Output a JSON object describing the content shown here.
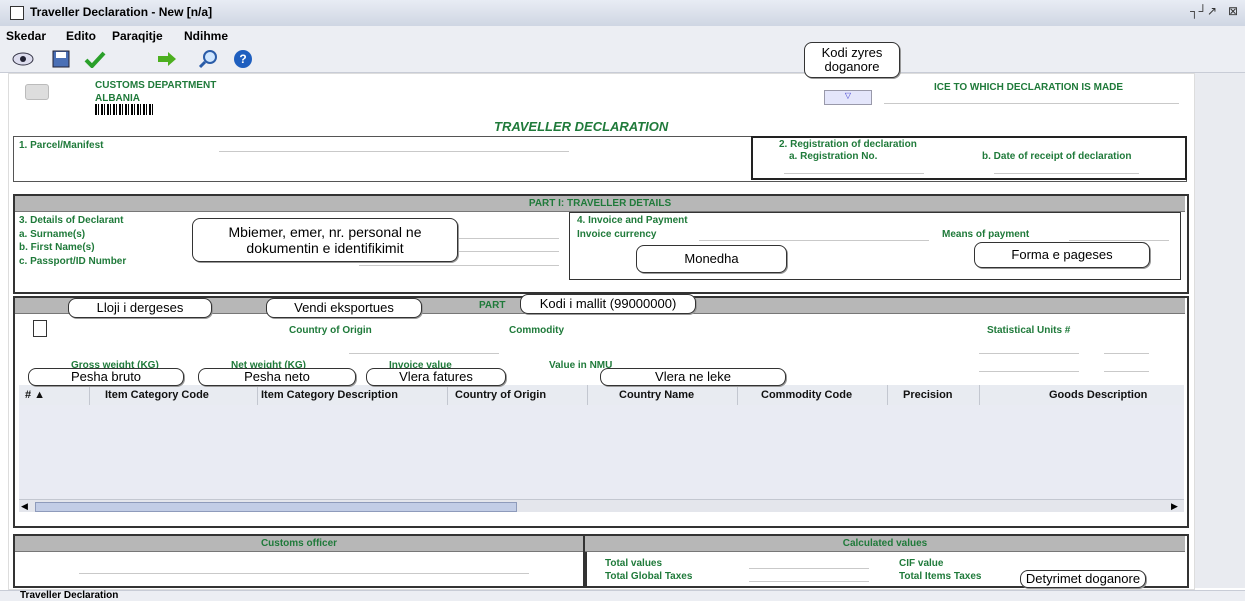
{
  "window": {
    "title": "Traveller Declaration - New [n/a]",
    "controls": [
      "┐┘",
      "↗",
      "⊠"
    ]
  },
  "menu": [
    "Skedar",
    "Edito",
    "Paraqitje",
    "Ndihme"
  ],
  "header": {
    "dept": "CUSTOMS DEPARTMENT",
    "country": "ALBANIA",
    "office_label": "ICE TO WHICH DECLARATION IS MADE",
    "form_title": "TRAVELLER DECLARATION"
  },
  "sections": {
    "parcel": "1. Parcel/Manifest",
    "registration": "2. Registration of declaration",
    "reg_no": "a. Registration No.",
    "receipt_date": "b. Date of receipt of declaration",
    "part1": "PART I: TRAVELLER DETAILS",
    "declarant": "3. Details of Declarant",
    "surname": "a. Surname(s)",
    "first_name": "b. First Name(s)",
    "passport": "c. Passport/ID Number",
    "invoice": "4. Invoice and Payment",
    "invoice_currency": "Invoice currency",
    "means_payment": "Means of payment",
    "part2": "PART",
    "country_origin": "Country of Origin",
    "commodity": "Commodity",
    "stat_units": "Statistical Units #",
    "gross_weight": "Gross weight (KG)",
    "net_weight": "Net weight (KG)",
    "invoice_value": "Invoice value",
    "value_nmu": "Value in NMU",
    "customs_officer": "Customs officer",
    "calculated": "Calculated values",
    "total_values": "Total values",
    "total_global_taxes": "Total Global Taxes",
    "cif_value": "CIF value",
    "total_items_taxes": "Total Items Taxes"
  },
  "grid": {
    "columns": [
      "# ▲",
      "Item Category Code",
      "Item Category Description",
      "Country of Origin",
      "Country Name",
      "Commodity Code",
      "Precision",
      "Goods Description"
    ]
  },
  "callouts": {
    "kodi_zyres": "Kodi zyres doganore",
    "mbiemer": "Mbiemer, emer, nr. personal ne dokumentin e identifikimit",
    "monedha": "Monedha",
    "forma": "Forma e pageses",
    "lloji": "Lloji i dergeses",
    "vendi": "Vendi eksportues",
    "kodi_mallit": "Kodi i mallit (99000000)",
    "pesha_bruto": "Pesha bruto",
    "pesha_neto": "Pesha neto",
    "vlera_fatures": "Vlera fatures",
    "vlera_leke": "Vlera ne leke",
    "detyrimet": "Detyrimet doganore"
  },
  "statusbar": {
    "tab": "Traveller Declaration"
  }
}
